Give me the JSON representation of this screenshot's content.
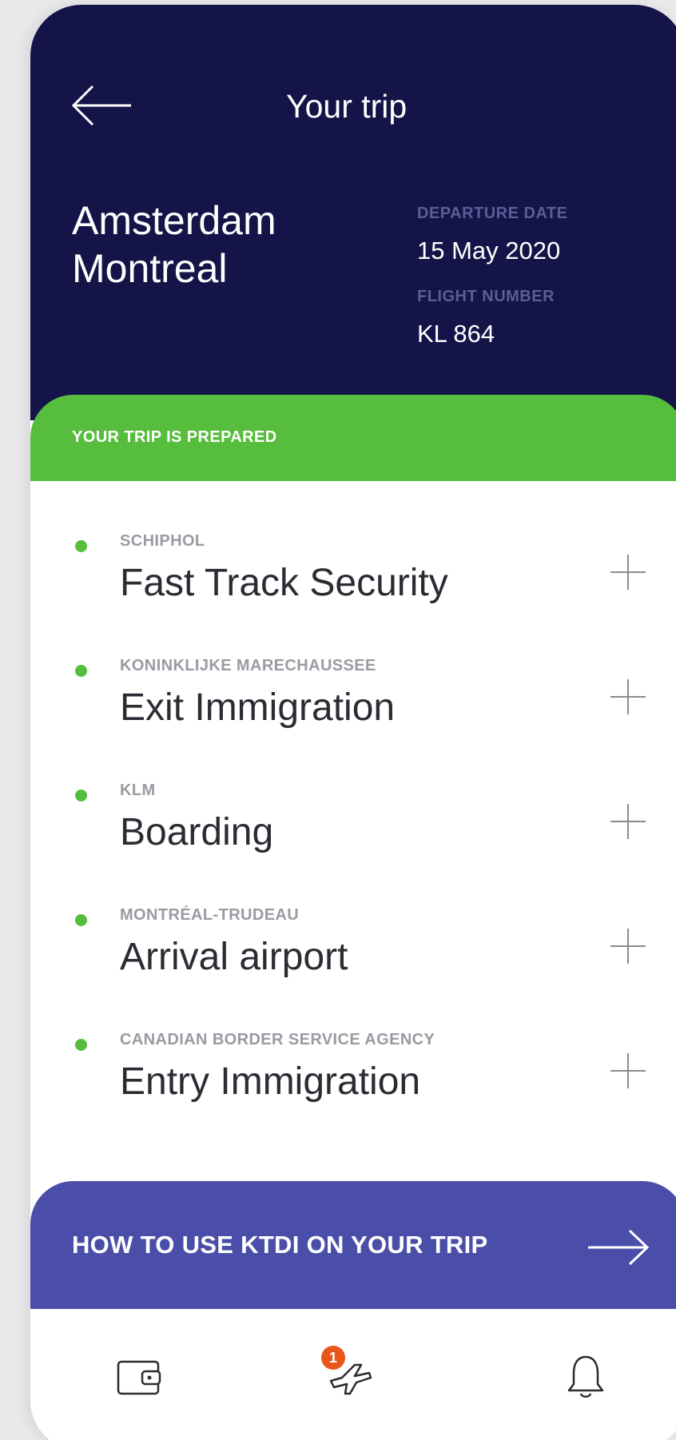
{
  "header": {
    "title": "Your trip",
    "route": {
      "origin": "Amsterdam",
      "destination": "Montreal"
    },
    "departure_label": "DEPARTURE DATE",
    "departure_date": "15 May 2020",
    "flight_label": "FLIGHT NUMBER",
    "flight_number": "KL 864"
  },
  "status": {
    "text": "YOUR TRIP IS PREPARED",
    "color": "#57bd3d"
  },
  "steps": [
    {
      "provider": "SCHIPHOL",
      "title": "Fast Track Security"
    },
    {
      "provider": "KONINKLIJKE MARECHAUSSEE",
      "title": "Exit Immigration"
    },
    {
      "provider": "KLM",
      "title": "Boarding"
    },
    {
      "provider": "MONTRÉAL-TRUDEAU",
      "title": "Arrival airport"
    },
    {
      "provider": "CANADIAN BORDER SERVICE AGENCY",
      "title": "Entry Immigration"
    }
  ],
  "cta": {
    "label": "HOW TO USE KTDI ON YOUR TRIP",
    "icon": "arrow-right-icon"
  },
  "bottom_nav": {
    "items": [
      {
        "name": "wallet",
        "icon": "wallet-icon"
      },
      {
        "name": "trips",
        "icon": "plane-icon",
        "badge": "1"
      },
      {
        "name": "notifications",
        "icon": "bell-icon"
      }
    ]
  },
  "colors": {
    "header_bg": "#141449",
    "accent_green": "#57bd3d",
    "cta_bg": "#4a4ea8",
    "badge": "#e9561a"
  }
}
